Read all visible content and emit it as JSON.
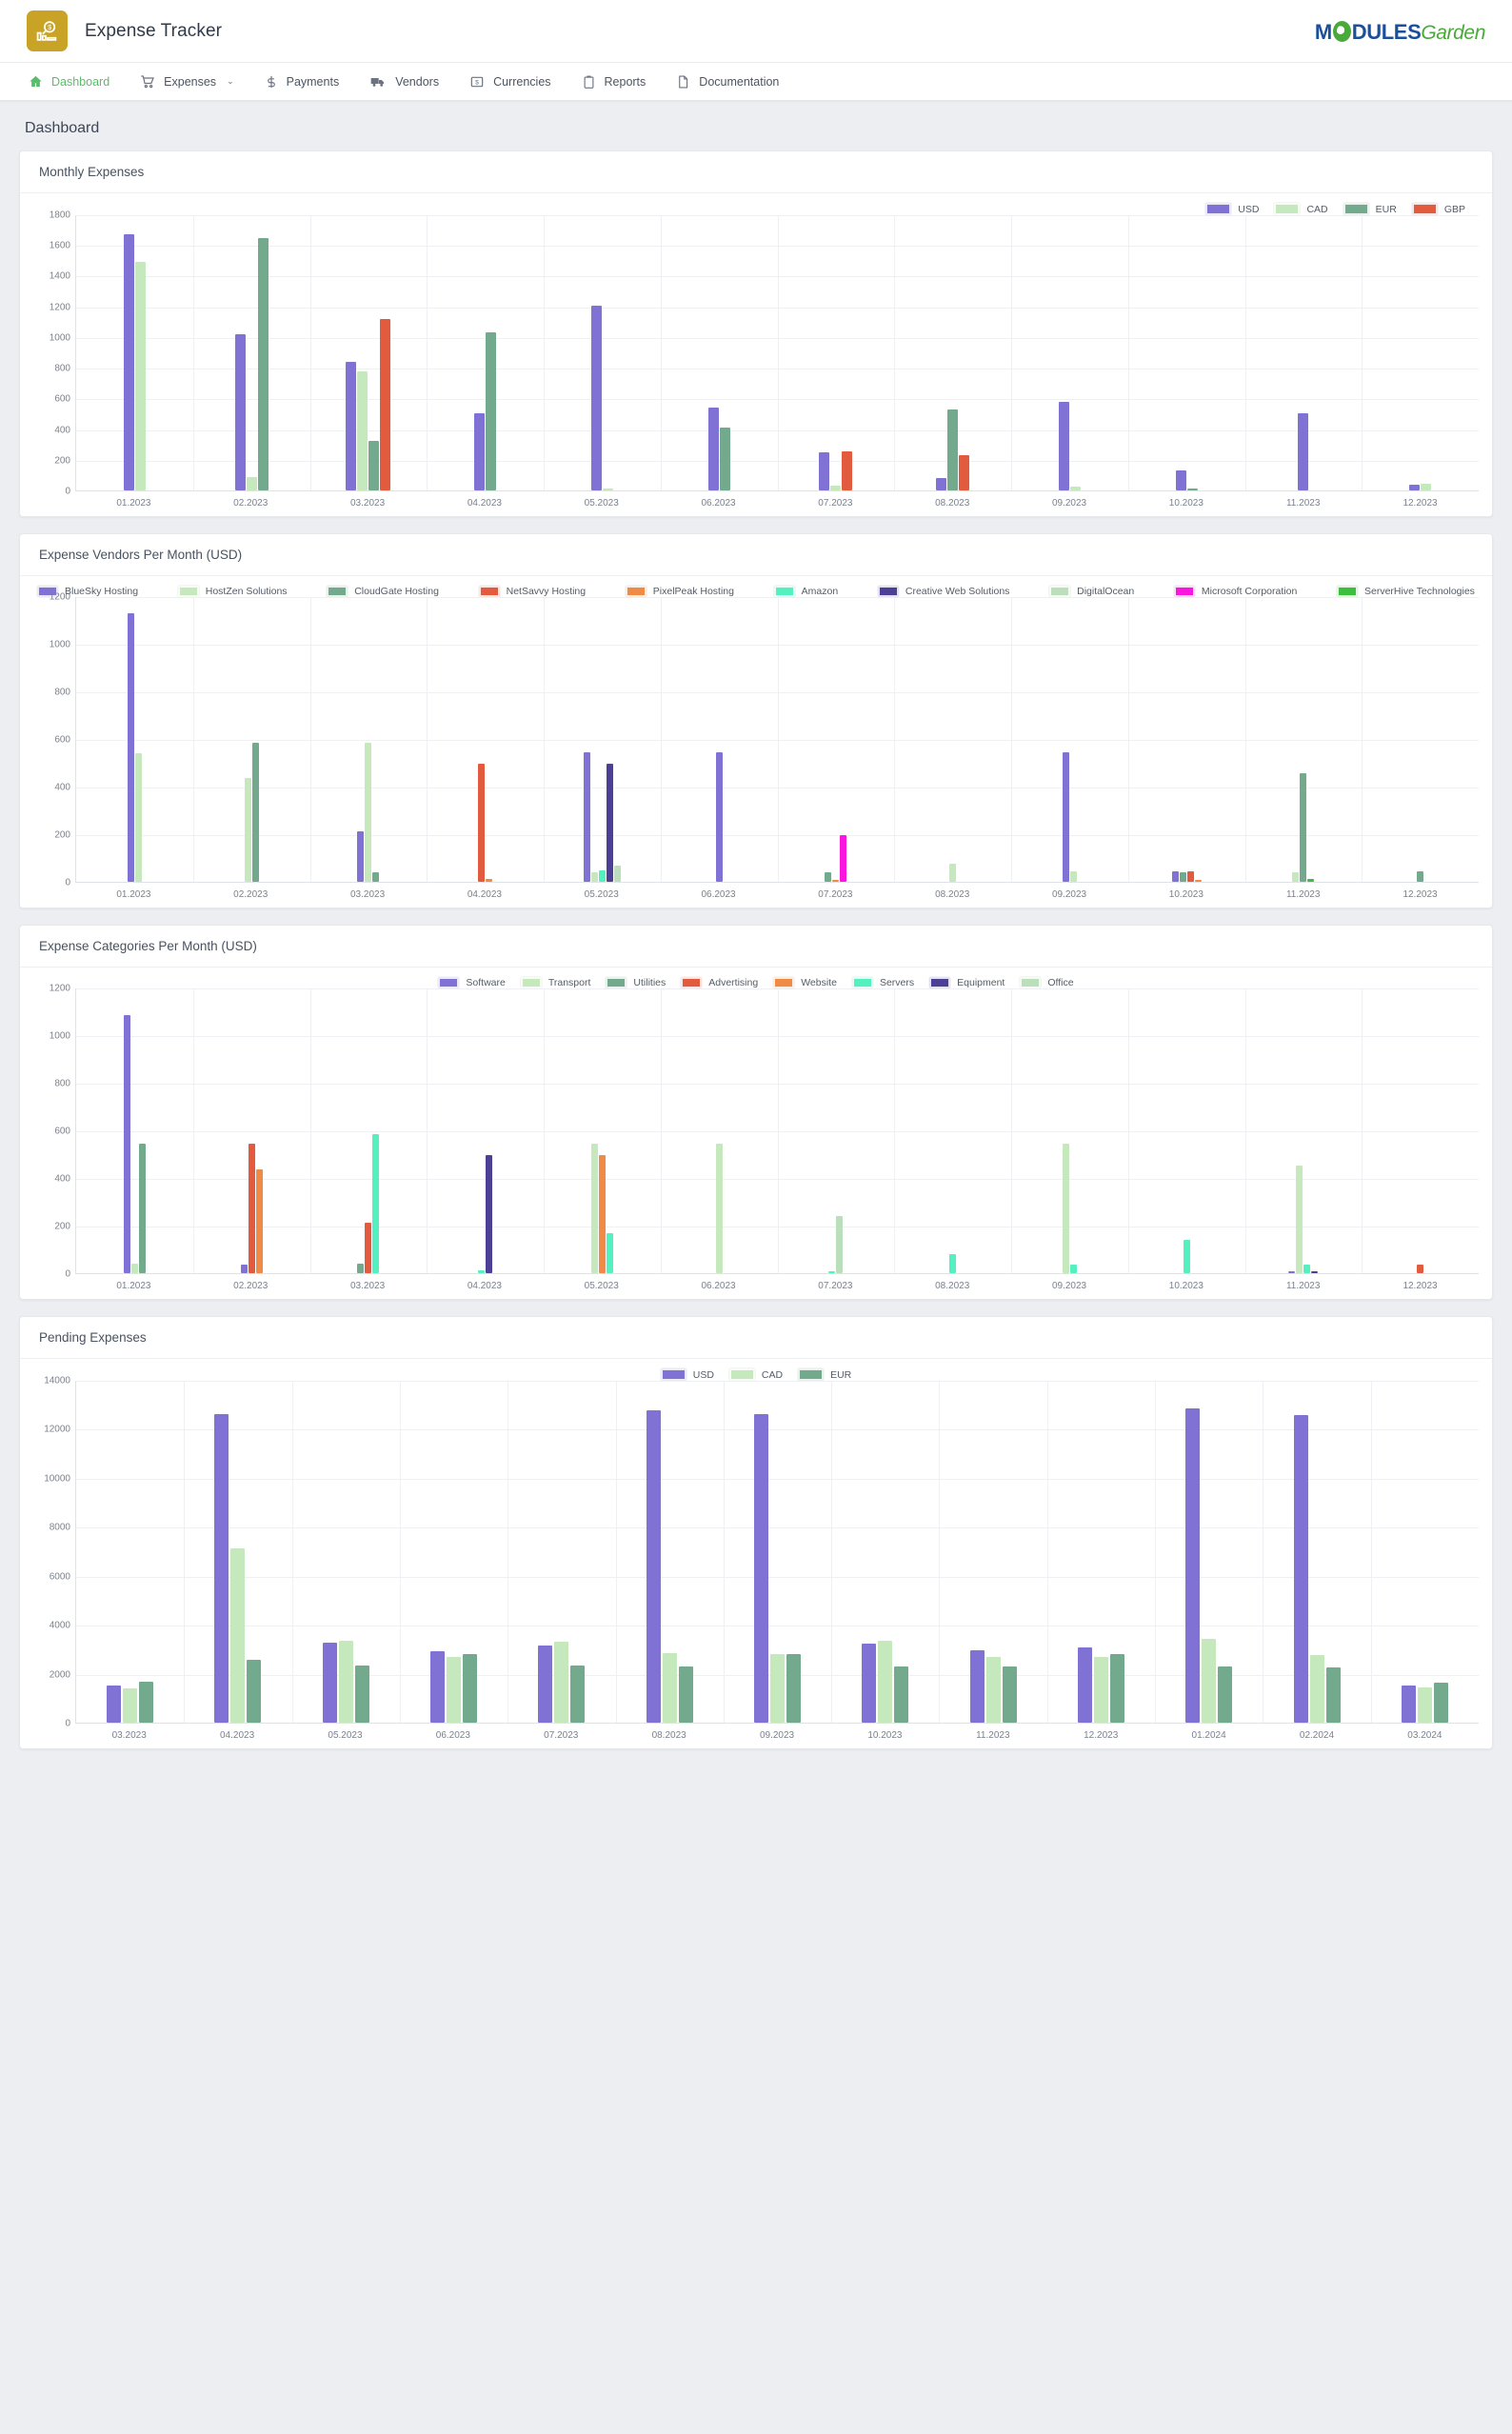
{
  "header": {
    "app_title": "Expense Tracker",
    "logo_icon": "expense-chart-magnifier-icon",
    "vendor_logo": {
      "part1": "M",
      "part2": "DULES",
      "part3": "Garden"
    }
  },
  "nav": {
    "items": [
      {
        "label": "Dashboard",
        "icon": "home-icon",
        "active": true,
        "caret": ""
      },
      {
        "label": "Expenses",
        "icon": "cart-icon",
        "active": false,
        "caret": "⌄"
      },
      {
        "label": "Payments",
        "icon": "dollar-icon",
        "active": false,
        "caret": ""
      },
      {
        "label": "Vendors",
        "icon": "truck-icon",
        "active": false,
        "caret": ""
      },
      {
        "label": "Currencies",
        "icon": "banknote-icon",
        "active": false,
        "caret": ""
      },
      {
        "label": "Reports",
        "icon": "clipboard-icon",
        "active": false,
        "caret": ""
      },
      {
        "label": "Documentation",
        "icon": "document-icon",
        "active": false,
        "caret": ""
      }
    ]
  },
  "page": {
    "title": "Dashboard"
  },
  "cards": [
    {
      "title": "Monthly Expenses"
    },
    {
      "title": "Expense Vendors Per Month (USD)"
    },
    {
      "title": "Expense Categories Per Month (USD)"
    },
    {
      "title": "Pending Expenses"
    }
  ],
  "palette": {
    "purple": "#7f72d4",
    "light_green": "#c6e8bd",
    "sea_green": "#73a98d",
    "red": "#e25b3f",
    "orange": "#ef8a47",
    "aqua": "#55f0c0",
    "dark_purple": "#4b3f96",
    "pale_green": "#bcdfbb",
    "magenta": "#f917e0",
    "grass_green": "#3dbf3d",
    "accent_green": "#5bbd6b",
    "brand_gold": "#c8a325"
  },
  "chart_data": [
    {
      "type": "bar",
      "title": "Monthly Expenses",
      "xlabel": "",
      "ylabel": "",
      "ylim": [
        0,
        1800
      ],
      "yticks": [
        0,
        200,
        400,
        600,
        800,
        1000,
        1200,
        1400,
        1600,
        1800
      ],
      "grid": true,
      "legend_position": "top-right",
      "categories": [
        "01.2023",
        "02.2023",
        "03.2023",
        "04.2023",
        "05.2023",
        "06.2023",
        "07.2023",
        "08.2023",
        "09.2023",
        "10.2023",
        "11.2023",
        "12.2023"
      ],
      "series": [
        {
          "name": "USD",
          "color": "#7f72d4",
          "values": [
            1670,
            1015,
            840,
            505,
            1207,
            543,
            250,
            78,
            580,
            130,
            500,
            38
          ]
        },
        {
          "name": "CAD",
          "color": "#c6e8bd",
          "values": [
            1490,
            90,
            778,
            0,
            8,
            0,
            33,
            0,
            25,
            0,
            0,
            43
          ]
        },
        {
          "name": "EUR",
          "color": "#73a98d",
          "values": [
            0,
            1645,
            325,
            1030,
            0,
            408,
            0,
            527,
            0,
            8,
            0,
            0
          ]
        },
        {
          "name": "GBP",
          "color": "#e25b3f",
          "values": [
            0,
            0,
            1120,
            0,
            0,
            0,
            255,
            232,
            0,
            0,
            0,
            0
          ]
        }
      ]
    },
    {
      "type": "bar",
      "title": "Expense Vendors Per Month (USD)",
      "xlabel": "",
      "ylabel": "",
      "ylim": [
        0,
        1200
      ],
      "yticks": [
        0,
        200,
        400,
        600,
        800,
        1000,
        1200
      ],
      "grid": true,
      "legend_position": "top-spread",
      "categories": [
        "01.2023",
        "02.2023",
        "03.2023",
        "04.2023",
        "05.2023",
        "06.2023",
        "07.2023",
        "08.2023",
        "09.2023",
        "10.2023",
        "11.2023",
        "12.2023"
      ],
      "series": [
        {
          "name": "BlueSky Hosting",
          "color": "#7f72d4",
          "values": [
            1130,
            0,
            213,
            0,
            543,
            543,
            0,
            0,
            543,
            45,
            0,
            0
          ]
        },
        {
          "name": "HostZen Solutions",
          "color": "#c6e8bd",
          "values": [
            540,
            435,
            585,
            0,
            42,
            0,
            0,
            78,
            45,
            0,
            42,
            0
          ]
        },
        {
          "name": "CloudGate Hosting",
          "color": "#73a98d",
          "values": [
            0,
            583,
            42,
            0,
            0,
            0,
            40,
            0,
            0,
            42,
            455,
            45
          ]
        },
        {
          "name": "NetSavvy Hosting",
          "color": "#e25b3f",
          "values": [
            0,
            0,
            0,
            497,
            0,
            0,
            0,
            0,
            0,
            44,
            0,
            0
          ]
        },
        {
          "name": "PixelPeak Hosting",
          "color": "#ef8a47",
          "values": [
            0,
            0,
            0,
            12,
            0,
            0,
            10,
            0,
            0,
            10,
            0,
            0
          ]
        },
        {
          "name": "Amazon",
          "color": "#55f0c0",
          "values": [
            0,
            0,
            0,
            0,
            50,
            0,
            0,
            0,
            0,
            0,
            0,
            0
          ]
        },
        {
          "name": "Creative Web Solutions",
          "color": "#4b3f96",
          "values": [
            0,
            0,
            0,
            0,
            497,
            0,
            0,
            0,
            0,
            0,
            0,
            0
          ]
        },
        {
          "name": "DigitalOcean",
          "color": "#bcdfbb",
          "values": [
            0,
            0,
            0,
            0,
            70,
            0,
            0,
            0,
            0,
            0,
            0,
            0
          ]
        },
        {
          "name": "Microsoft Corporation",
          "color": "#f917e0",
          "values": [
            0,
            0,
            0,
            0,
            0,
            0,
            198,
            0,
            0,
            0,
            0,
            0
          ]
        },
        {
          "name": "ServerHive Technologies",
          "color": "#3dbf3d",
          "values": [
            0,
            0,
            0,
            0,
            0,
            0,
            0,
            0,
            0,
            0,
            12,
            0
          ]
        }
      ]
    },
    {
      "type": "bar",
      "title": "Expense Categories Per Month (USD)",
      "xlabel": "",
      "ylabel": "",
      "ylim": [
        0,
        1200
      ],
      "yticks": [
        0,
        200,
        400,
        600,
        800,
        1000,
        1200
      ],
      "grid": true,
      "legend_position": "top-center",
      "categories": [
        "01.2023",
        "02.2023",
        "03.2023",
        "04.2023",
        "05.2023",
        "06.2023",
        "07.2023",
        "08.2023",
        "09.2023",
        "10.2023",
        "11.2023",
        "12.2023"
      ],
      "series": [
        {
          "name": "Software",
          "color": "#7f72d4",
          "values": [
            1085,
            38,
            0,
            0,
            0,
            0,
            0,
            0,
            0,
            0,
            8,
            0
          ]
        },
        {
          "name": "Transport",
          "color": "#c6e8bd",
          "values": [
            40,
            0,
            0,
            0,
            543,
            543,
            0,
            0,
            543,
            0,
            452,
            0
          ]
        },
        {
          "name": "Utilities",
          "color": "#73a98d",
          "values": [
            543,
            0,
            40,
            0,
            0,
            0,
            0,
            0,
            0,
            0,
            0,
            0
          ]
        },
        {
          "name": "Advertising",
          "color": "#e25b3f",
          "values": [
            0,
            543,
            213,
            0,
            0,
            0,
            0,
            0,
            0,
            0,
            0,
            38
          ]
        },
        {
          "name": "Website",
          "color": "#ef8a47",
          "values": [
            0,
            435,
            0,
            0,
            497,
            0,
            0,
            0,
            0,
            0,
            0,
            0
          ]
        },
        {
          "name": "Servers",
          "color": "#55f0c0",
          "values": [
            0,
            0,
            585,
            12,
            168,
            0,
            10,
            80,
            38,
            140,
            35,
            0
          ]
        },
        {
          "name": "Equipment",
          "color": "#4b3f96",
          "values": [
            0,
            0,
            0,
            497,
            0,
            0,
            0,
            0,
            0,
            0,
            8,
            0
          ]
        },
        {
          "name": "Office",
          "color": "#bcdfbb",
          "values": [
            0,
            0,
            0,
            0,
            0,
            0,
            240,
            0,
            0,
            0,
            0,
            0
          ]
        }
      ]
    },
    {
      "type": "bar",
      "title": "Pending Expenses",
      "xlabel": "",
      "ylabel": "",
      "ylim": [
        0,
        14000
      ],
      "yticks": [
        0,
        2000,
        4000,
        6000,
        8000,
        10000,
        12000,
        14000
      ],
      "grid": true,
      "legend_position": "top-center",
      "categories": [
        "03.2023",
        "04.2023",
        "05.2023",
        "06.2023",
        "07.2023",
        "08.2023",
        "09.2023",
        "10.2023",
        "11.2023",
        "12.2023",
        "01.2024",
        "02.2024",
        "03.2024"
      ],
      "series": [
        {
          "name": "USD",
          "color": "#7f72d4",
          "values": [
            1520,
            12600,
            3250,
            2920,
            3170,
            12750,
            12600,
            3210,
            2960,
            3080,
            12850,
            12550,
            1500
          ]
        },
        {
          "name": "CAD",
          "color": "#c6e8bd",
          "values": [
            1390,
            7120,
            3350,
            2700,
            3310,
            2830,
            2790,
            3330,
            2700,
            2670,
            3420,
            2760,
            1440
          ]
        },
        {
          "name": "EUR",
          "color": "#73a98d",
          "values": [
            1660,
            2580,
            2340,
            2820,
            2340,
            2290,
            2820,
            2290,
            2300,
            2800,
            2300,
            2270,
            1640
          ]
        }
      ]
    }
  ]
}
